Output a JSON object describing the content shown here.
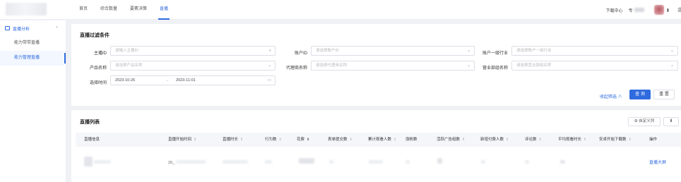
{
  "nav": {
    "items": [
      "首页",
      "综合数量",
      "要素决策",
      "直播"
    ],
    "active_index": 3
  },
  "top_right": {
    "download": "下载中心",
    "user_prefix": "专",
    "cut_char": "北"
  },
  "sidebar": {
    "group_label": "直播分析",
    "items": [
      {
        "label": "能力带带直播",
        "active": false
      },
      {
        "label": "能力管理直播",
        "active": true
      }
    ]
  },
  "filter": {
    "title": "直播过滤条件",
    "fields": {
      "anchor_id": {
        "label": "主播ID",
        "placeholder": "请输入主播ID"
      },
      "account_id": {
        "label": "账户ID",
        "placeholder": "请选择账户ID"
      },
      "industry": {
        "label": "账户一级行业",
        "placeholder": "请选择账户一级行业"
      },
      "product": {
        "label": "产品名称",
        "placeholder": "请选择产品名称"
      },
      "agent": {
        "label": "代理商名称",
        "placeholder": "请选择代理商名称"
      },
      "dept": {
        "label": "营业部组名称",
        "placeholder": "请选择营业部组名称"
      },
      "time": {
        "label": "选择时间",
        "start": "2023-10-26",
        "separator": "→",
        "end": "2023-11-01"
      }
    },
    "collapse": "收起筛选 ∧",
    "query": "查 询",
    "reset": "重 置"
  },
  "list": {
    "title": "直播列表",
    "custom_columns": "⚙ 自定义列",
    "export": "⬇",
    "columns": [
      {
        "label": "直播信息",
        "sort": false
      },
      {
        "label": "直播开始时间",
        "sort": true
      },
      {
        "label": "直播时长",
        "sort": true
      },
      {
        "label": "行为数",
        "sort": true
      },
      {
        "label": "花费",
        "sort": true
      },
      {
        "label": "表单提交数",
        "sort": true
      },
      {
        "label": "累计观看人数",
        "sort": true
      },
      {
        "label": "涨粉数",
        "sort": false
      },
      {
        "label": "活跃广告组数",
        "sort": true
      },
      {
        "label": "新增付费人数",
        "sort": true
      },
      {
        "label": "评论数",
        "sort": true
      },
      {
        "label": "平均观看时长",
        "sort": true
      },
      {
        "label": "安卓开始下载数",
        "sort": true
      },
      {
        "label": "操作",
        "sort": false
      }
    ],
    "row": {
      "start_time_partial": "20_",
      "action": "直播大屏"
    }
  },
  "icons": {
    "search": "search-icon",
    "dropdown": "chevron-down-icon",
    "calendar": "calendar-icon",
    "sort": "sort-icon"
  },
  "colors": {
    "accent": "#2f6bdf",
    "background": "#f0f1f5"
  }
}
